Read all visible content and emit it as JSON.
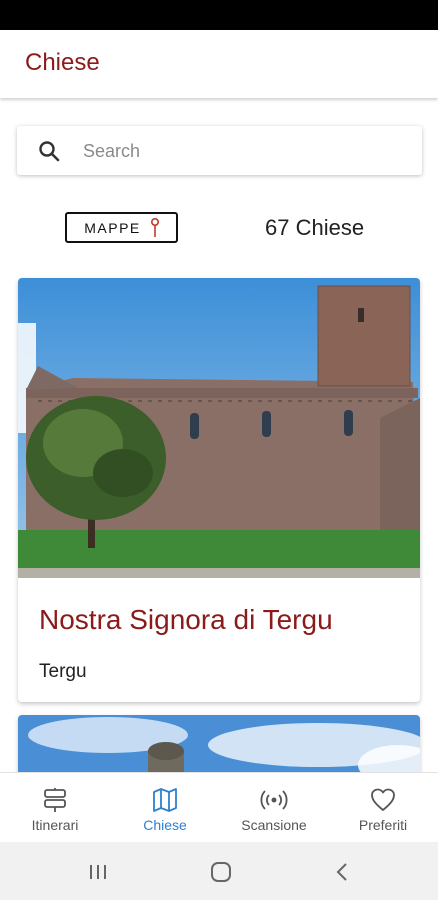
{
  "header": {
    "title": "Chiese"
  },
  "search": {
    "placeholder": "Search",
    "value": ""
  },
  "toolbar": {
    "maps_label": "MAPPE",
    "count_label": "67 Chiese"
  },
  "cards": [
    {
      "title": "Nostra Signora di Tergu",
      "subtitle": "Tergu"
    }
  ],
  "bottom_nav": {
    "items": [
      {
        "label": "Itinerari",
        "icon": "signpost-icon",
        "active": false
      },
      {
        "label": "Chiese",
        "icon": "map-icon",
        "active": true
      },
      {
        "label": "Scansione",
        "icon": "broadcast-icon",
        "active": false
      },
      {
        "label": "Preferiti",
        "icon": "heart-icon",
        "active": false
      }
    ]
  },
  "colors": {
    "accent": "#8b1a1a",
    "nav_active": "#2f80d0"
  }
}
